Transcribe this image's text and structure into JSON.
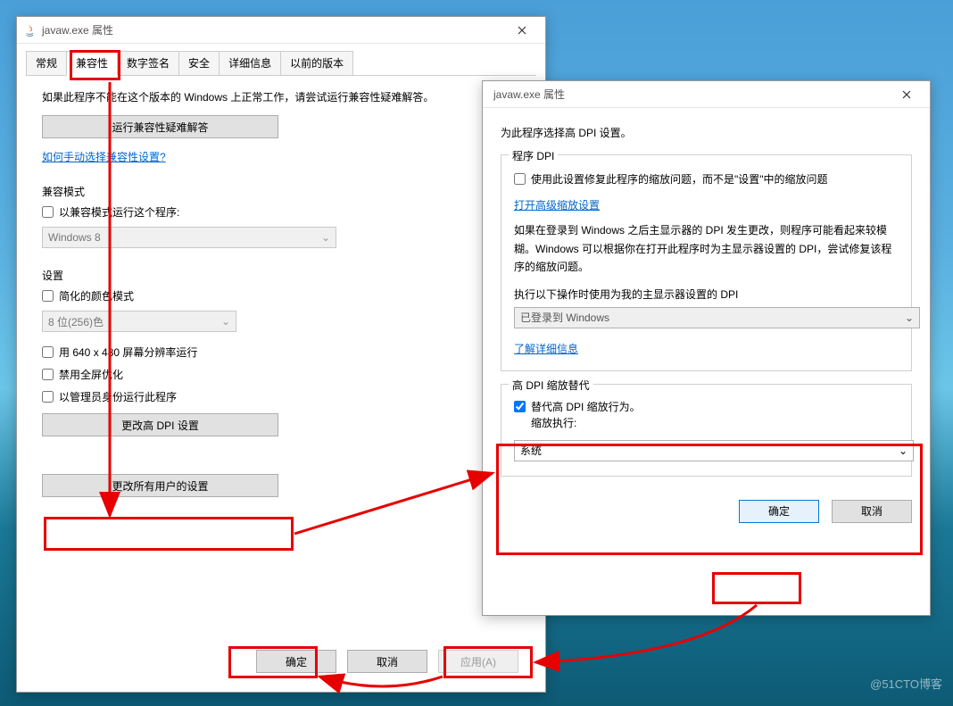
{
  "watermark": "@51CTO博客",
  "dlg1": {
    "title": "javaw.exe 属性",
    "tabs": [
      "常规",
      "兼容性",
      "数字签名",
      "安全",
      "详细信息",
      "以前的版本"
    ],
    "active_tab_index": 1,
    "help_text": "如果此程序不能在这个版本的 Windows 上正常工作，请尝试运行兼容性疑难解答。",
    "btn_troubleshoot": "运行兼容性疑难解答",
    "link_manual": "如何手动选择兼容性设置?",
    "section_mode": "兼容模式",
    "chk_compat_mode": "以兼容模式运行这个程序:",
    "select_os": "Windows 8",
    "section_settings": "设置",
    "chk_reduced_color": "简化的颜色模式",
    "select_color": "8 位(256)色",
    "chk_640x480": "用 640 x 480 屏幕分辨率运行",
    "chk_disable_fullscreen": "禁用全屏优化",
    "chk_admin": "以管理员身份运行此程序",
    "btn_high_dpi": "更改高 DPI 设置",
    "btn_all_users": "更改所有用户的设置",
    "btn_ok": "确定",
    "btn_cancel": "取消",
    "btn_apply": "应用(A)"
  },
  "dlg2": {
    "title": "javaw.exe 属性",
    "intro": "为此程序选择高 DPI 设置。",
    "group1_title": "程序 DPI",
    "chk_use_setting": "使用此设置修复此程序的缩放问题，而不是\"设置\"中的缩放问题",
    "link_advanced": "打开高级缩放设置",
    "para1": "如果在登录到 Windows 之后主显示器的 DPI 发生更改，则程序可能看起来较模糊。Windows 可以根据你在打开此程序时为主显示器设置的 DPI，尝试修复该程序的缩放问题。",
    "label_when": "执行以下操作时使用为我的主显示器设置的 DPI",
    "select_when": "已登录到 Windows",
    "link_learn": "了解详细信息",
    "group2_title": "高 DPI 缩放替代",
    "chk_override_line1": "替代高 DPI 缩放行为。",
    "chk_override_line2": "缩放执行:",
    "select_override": "系统",
    "btn_ok": "确定",
    "btn_cancel": "取消"
  }
}
